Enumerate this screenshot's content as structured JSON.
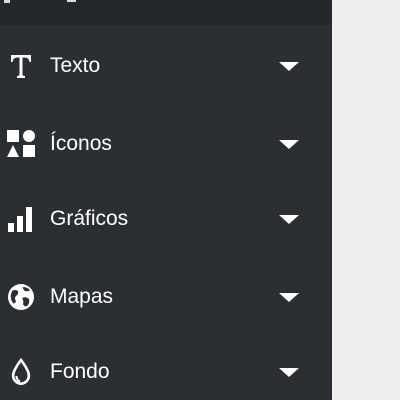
{
  "sidebar": {
    "items": [
      {
        "label": "Texto",
        "icon": "text-t-icon"
      },
      {
        "label": "Íconos",
        "icon": "shapes-icon"
      },
      {
        "label": "Gráficos",
        "icon": "bar-chart-icon"
      },
      {
        "label": "Mapas",
        "icon": "globe-icon"
      },
      {
        "label": "Fondo",
        "icon": "droplet-icon"
      }
    ]
  }
}
